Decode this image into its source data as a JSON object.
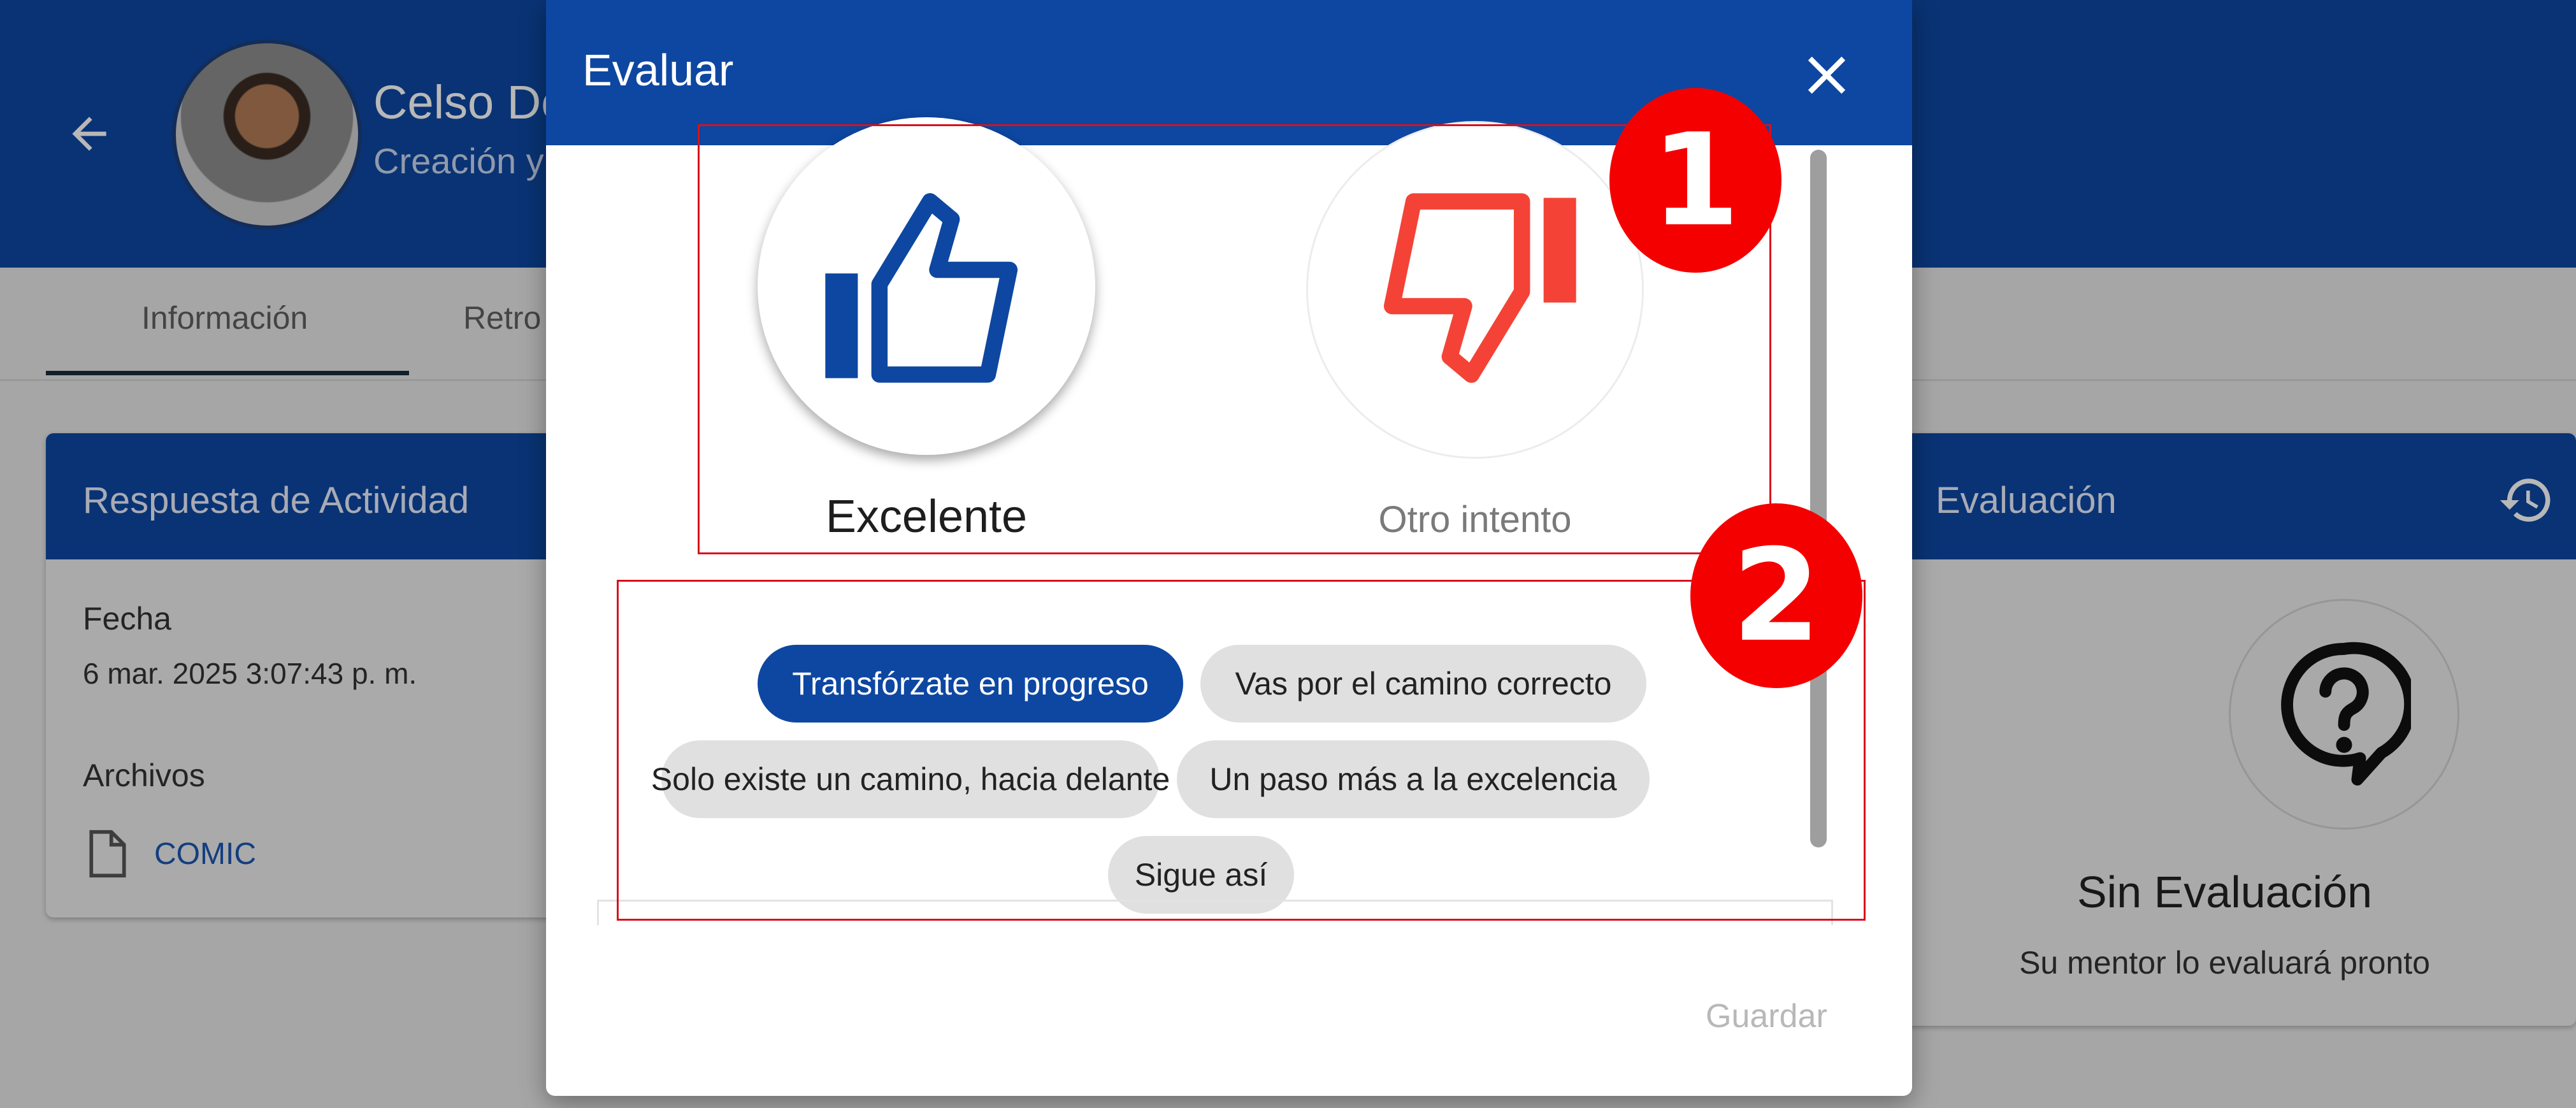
{
  "header": {
    "user_name": "Celso Do",
    "user_subtitle": "Creación y"
  },
  "tabs": [
    {
      "label": "Información",
      "active": true
    },
    {
      "label": "Retro",
      "active": false
    }
  ],
  "activity_card": {
    "title": "Respuesta de Actividad",
    "date_label": "Fecha",
    "date_value": "6 mar. 2025 3:07:43 p. m.",
    "files_label": "Archivos",
    "file_name": "COMIC"
  },
  "evaluation_card": {
    "title": "Evaluación",
    "status": "Sin Evaluación",
    "status_sub": "Su mentor lo evaluará pronto"
  },
  "dialog": {
    "title": "Evaluar",
    "options": [
      {
        "label": "Excelente",
        "icon": "thumbs-up-icon",
        "selected": true,
        "color": "#0d47a1"
      },
      {
        "label": "Otro intento",
        "icon": "thumbs-down-icon",
        "selected": false,
        "color": "#f44336"
      }
    ],
    "chips": [
      {
        "label": "Transfórzate en progreso",
        "selected": true
      },
      {
        "label": "Vas por el camino correcto",
        "selected": false
      },
      {
        "label": "Solo existe un camino, hacia delante",
        "selected": false
      },
      {
        "label": "Un paso más a la excelencia",
        "selected": false
      },
      {
        "label": "Sigue así",
        "selected": false
      }
    ],
    "save_label": "Guardar"
  },
  "annotations": [
    "1",
    "2"
  ],
  "colors": {
    "primary": "#0d47a1",
    "danger": "#f44336",
    "annotation_red": "#f40000"
  }
}
